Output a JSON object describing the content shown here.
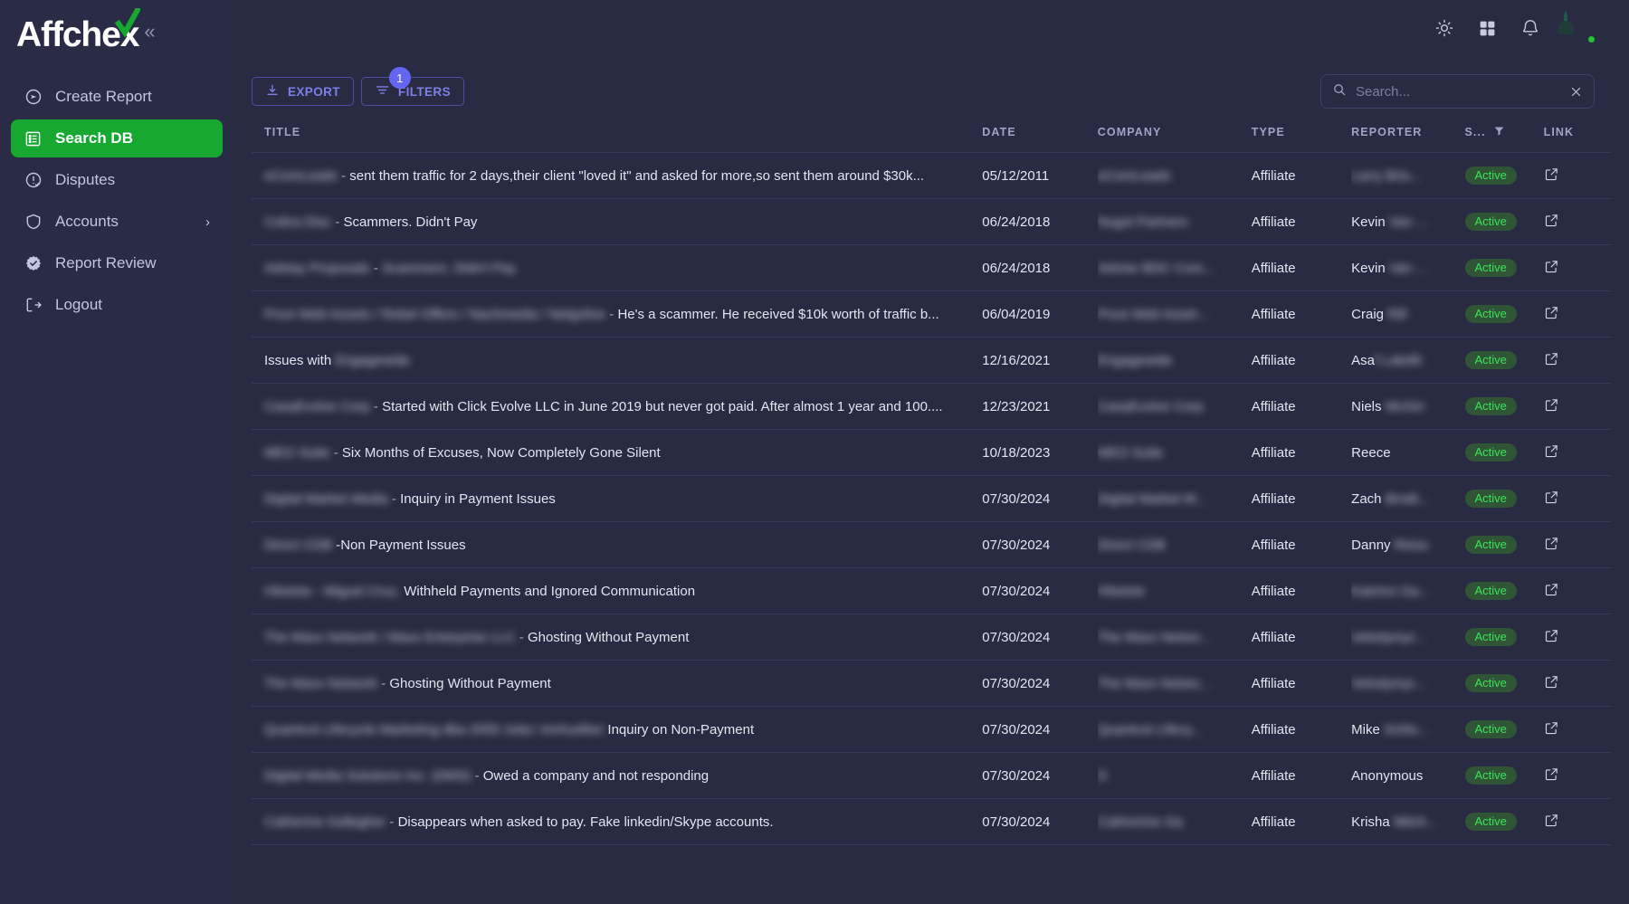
{
  "brand": {
    "name": "Affchex",
    "collapse_icon": "chevrons-left-icon"
  },
  "sidebar": {
    "items": [
      {
        "label": "Create Report",
        "icon": "send-circle-icon",
        "active": false,
        "has_chevron": false
      },
      {
        "label": "Search DB",
        "icon": "list-box-icon",
        "active": true,
        "has_chevron": false
      },
      {
        "label": "Disputes",
        "icon": "alert-circle-icon",
        "active": false,
        "has_chevron": false
      },
      {
        "label": "Accounts",
        "icon": "shield-icon",
        "active": false,
        "has_chevron": true
      },
      {
        "label": "Report Review",
        "icon": "verified-badge-icon",
        "active": false,
        "has_chevron": false
      },
      {
        "label": "Logout",
        "icon": "logout-icon",
        "active": false,
        "has_chevron": false
      }
    ]
  },
  "topbar": {
    "icons": [
      "brightness-icon",
      "grid-apps-icon",
      "bell-icon"
    ],
    "avatar": {
      "name": "user-avatar",
      "status": "online"
    }
  },
  "toolbar": {
    "export_label": "EXPORT",
    "filters_label": "FILTERS",
    "filters_count": "1"
  },
  "search": {
    "value": "",
    "placeholder": "Search..."
  },
  "table": {
    "headers": {
      "title": "TITLE",
      "date": "DATE",
      "company": "COMPANY",
      "type": "TYPE",
      "reporter": "REPORTER",
      "status": "S...",
      "link": "LINK"
    },
    "rows": [
      {
        "company_redacted": "eComLeads",
        "title": "sent them traffic for 2 days,their client \"loved it\" and asked for more,so sent them around $30k...",
        "title_redacted": false,
        "date": "05/12/2011",
        "company": "eComLeads",
        "type": "Affiliate",
        "reporter_visible": "",
        "reporter_redacted": "Larry Bris...",
        "status": "Active",
        "link": "external-link-icon"
      },
      {
        "company_redacted": "Cobra Disc",
        "title": "Scammers. Didn't Pay",
        "title_redacted": false,
        "date": "06/24/2018",
        "company": "Nugol Partners",
        "type": "Affiliate",
        "reporter_visible": "Kevin ",
        "reporter_redacted": "Van ...",
        "status": "Active",
        "link": "external-link-icon"
      },
      {
        "company_redacted": "Adstay Proposals",
        "title": "Scammers. Didn't Pay",
        "title_redacted": true,
        "date": "06/24/2018",
        "company": "Advise BDC Com...",
        "type": "Affiliate",
        "reporter_visible": "Kevin ",
        "reporter_redacted": "Van ...",
        "status": "Active",
        "link": "external-link-icon"
      },
      {
        "company_redacted": "Proxi Web Assets / Rebel Offers / Nachmedia / Netgolive",
        "title": "He's a scammer. He received $10k worth of traffic b...",
        "title_redacted": false,
        "date": "06/04/2019",
        "company": "Proxi Web Asset...",
        "type": "Affiliate",
        "reporter_visible": "Craig ",
        "reporter_redacted": "Rill",
        "status": "Active",
        "link": "external-link-icon"
      },
      {
        "company_redacted": "Engagewide",
        "title": "Issues with ",
        "title_redacted": false,
        "title_prefix": true,
        "date": "12/16/2021",
        "company": "Engagewide",
        "type": "Affiliate",
        "reporter_visible": "Asa",
        "reporter_redacted": "f Lakidh",
        "status": "Active",
        "link": "external-link-icon"
      },
      {
        "company_redacted": "CasaEvolve Corp",
        "title": "Started with Click Evolve LLC in June 2019 but never got paid. After almost 1 year and 100....",
        "title_redacted": false,
        "date": "12/23/2021",
        "company": "CasaEvolve Corp",
        "type": "Affiliate",
        "reporter_visible": "Niels ",
        "reporter_redacted": "McGin",
        "status": "Active",
        "link": "external-link-icon"
      },
      {
        "company_redacted": "MEO Suite",
        "title": "Six Months of Excuses, Now Completely Gone Silent",
        "title_redacted": false,
        "date": "10/18/2023",
        "company": "MEO Suite",
        "type": "Affiliate",
        "reporter_visible": "Reece",
        "reporter_redacted": "",
        "status": "Active",
        "link": "external-link-icon"
      },
      {
        "company_redacted": "Digital Market Media",
        "title": "Inquiry in Payment Issues",
        "title_redacted": false,
        "date": "07/30/2024",
        "company": "Digital Market M...",
        "type": "Affiliate",
        "reporter_visible": "Zach ",
        "reporter_redacted": "Brodt...",
        "status": "Active",
        "link": "external-link-icon"
      },
      {
        "company_redacted": "Direct CDB",
        "title": "Non Payment Issues",
        "title_redacted": false,
        "no_space": true,
        "date": "07/30/2024",
        "company": "Direct CDB",
        "type": "Affiliate",
        "reporter_visible": "Danny ",
        "reporter_redacted": "Reiss",
        "status": "Active",
        "link": "external-link-icon"
      },
      {
        "company_redacted": "Hitwisto - Miguel Cruz,",
        "title": "Withheld Payments and Ignored Communication",
        "title_redacted": false,
        "no_dash": true,
        "date": "07/30/2024",
        "company": "Hitwisto",
        "type": "Affiliate",
        "reporter_visible": "",
        "reporter_redacted": "Katrinci Ga...",
        "status": "Active",
        "link": "external-link-icon"
      },
      {
        "company_redacted": "The Maxx Network / Maxx Enterprise LLC",
        "title": "Ghosting Without Payment",
        "title_redacted": false,
        "date": "07/30/2024",
        "company": "The Maxx Netwo...",
        "type": "Affiliate",
        "reporter_visible": "",
        "reporter_redacted": "Velodymyr...",
        "status": "Active",
        "link": "external-link-icon"
      },
      {
        "company_redacted": "The Maxx Network",
        "title": "Ghosting Without Payment",
        "title_redacted": false,
        "date": "07/30/2024",
        "company": "The Maxx Netwo...",
        "type": "Affiliate",
        "reporter_visible": "",
        "reporter_redacted": "Velodymyr...",
        "status": "Active",
        "link": "external-link-icon"
      },
      {
        "company_redacted": "Quantcot Lifecycle Marketing dba 2050 Julez Vorhuelker",
        "title": "Inquiry on Non-Payment",
        "title_redacted": false,
        "no_dash": true,
        "date": "07/30/2024",
        "company": "Quantcot Lifecy...",
        "type": "Affiliate",
        "reporter_visible": "Mike ",
        "reporter_redacted": "Schlo...",
        "status": "Active",
        "link": "external-link-icon"
      },
      {
        "company_redacted": "Digital Media Solutions Inc. (DMS)",
        "title": "Owed a company and not responding",
        "title_redacted": false,
        "date": "07/30/2024",
        "company": "D",
        "type": "Affiliate",
        "reporter_visible": "Anonymous",
        "reporter_redacted": "",
        "status": "Active",
        "link": "external-link-icon"
      },
      {
        "company_redacted": "Catherine Gallagher",
        "title": "Disappears when asked to pay. Fake linkedin/Skype accounts.",
        "title_redacted": false,
        "date": "07/30/2024",
        "company": "Cathrerine Ga",
        "type": "Affiliate",
        "reporter_visible": "Krisha ",
        "reporter_redacted": "Mitch...",
        "status": "Active",
        "link": "external-link-icon"
      }
    ]
  },
  "colors": {
    "sidebar_bg": "#2A2C45",
    "page_bg": "#292B42",
    "accent_green": "#16A831",
    "accent_indigo": "#6366F1",
    "badge_text": "#3BE35B",
    "badge_bg": "#2F5536",
    "row_divider": "#383B57"
  }
}
